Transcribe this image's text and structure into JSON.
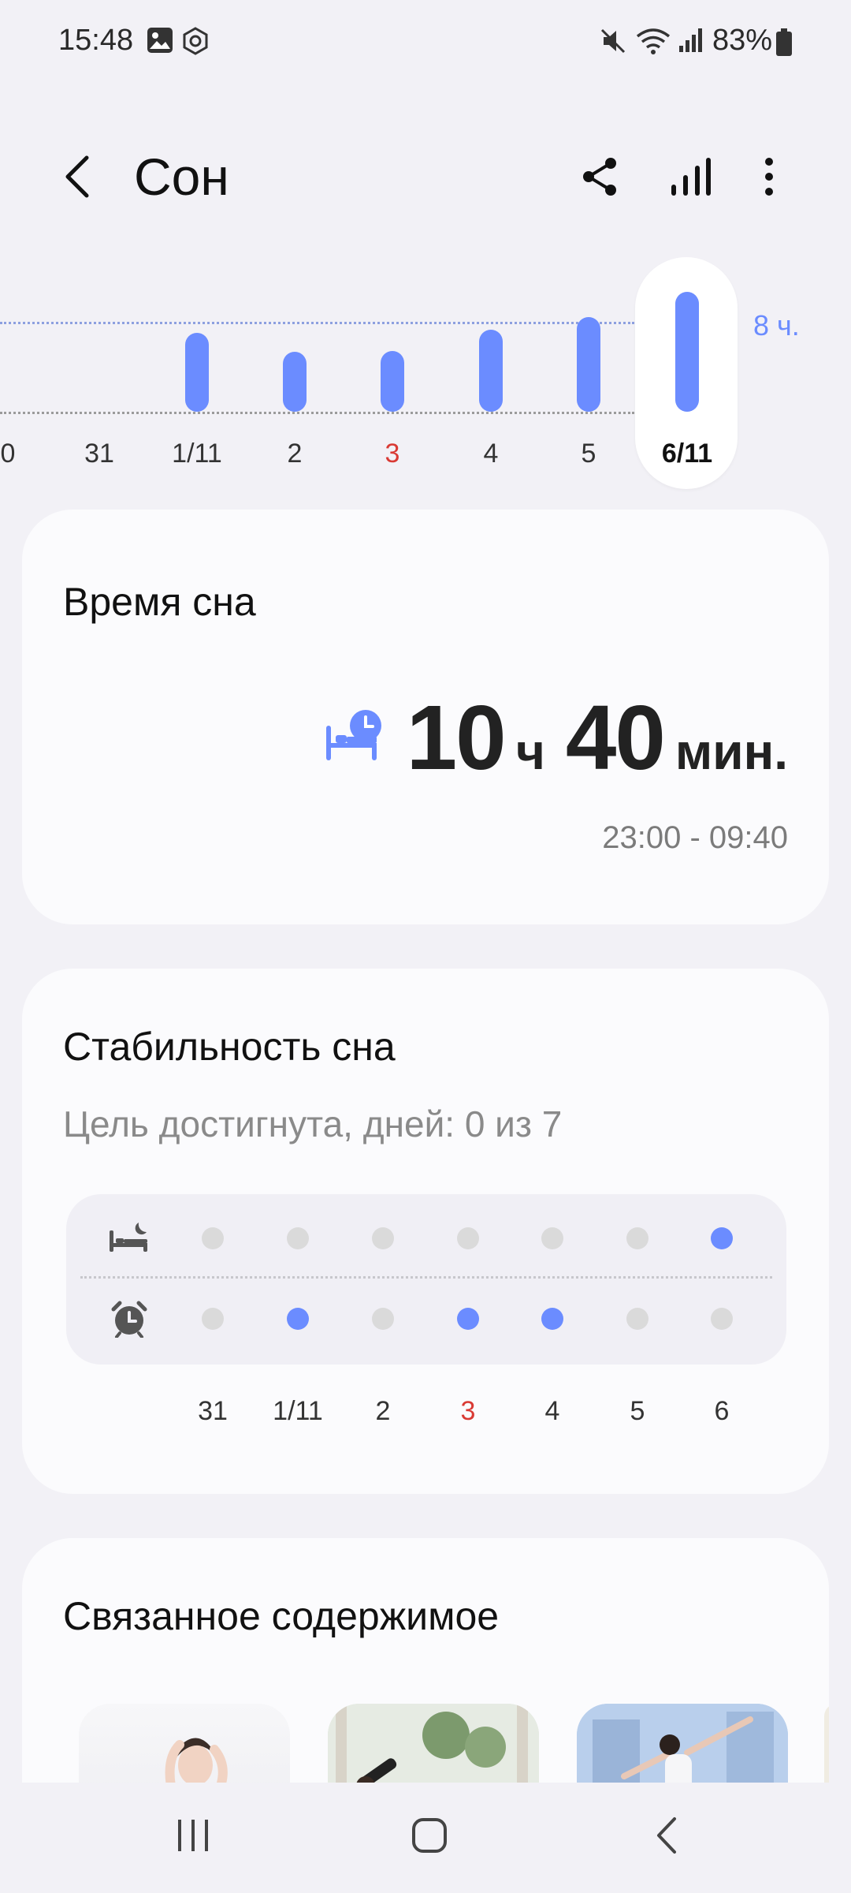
{
  "status_bar": {
    "time": "15:48",
    "battery": "83%",
    "icons": [
      "gallery-icon",
      "sync-icon",
      "mute-icon",
      "wifi-icon",
      "signal-icon",
      "battery-icon"
    ]
  },
  "header": {
    "back_icon": "chevron-left-icon",
    "title": "Сон",
    "actions": [
      "share-icon",
      "chart-icon",
      "more-vertical-icon"
    ]
  },
  "week_chart": {
    "goal_label": "8 ч.",
    "selected_day": "6/11",
    "days": [
      {
        "label": "0",
        "hours": null,
        "red": false
      },
      {
        "label": "31",
        "hours": null,
        "red": false
      },
      {
        "label": "1/11",
        "hours": 7.0,
        "red": false
      },
      {
        "label": "2",
        "hours": 5.3,
        "red": false
      },
      {
        "label": "3",
        "hours": 5.4,
        "red": true
      },
      {
        "label": "4",
        "hours": 7.3,
        "red": false
      },
      {
        "label": "5",
        "hours": 8.4,
        "red": false
      },
      {
        "label": "6/11",
        "hours": 10.67,
        "red": false
      }
    ]
  },
  "sleep_time": {
    "title": "Время сна",
    "icon": "bed-clock-icon",
    "hours": "10",
    "hours_unit": "ч",
    "minutes": "40",
    "minutes_unit": "мин.",
    "range": "23:00 - 09:40"
  },
  "consistency": {
    "title": "Стабильность сна",
    "subtitle": "Цель достигнута, дней: 0 из 7",
    "bedtime_icon": "bedtime-icon",
    "wakeup_icon": "alarm-clock-icon",
    "days": [
      {
        "label": "31",
        "red": false,
        "bedtime": false,
        "wakeup": false
      },
      {
        "label": "1/11",
        "red": false,
        "bedtime": false,
        "wakeup": true
      },
      {
        "label": "2",
        "red": false,
        "bedtime": false,
        "wakeup": false
      },
      {
        "label": "3",
        "red": true,
        "bedtime": false,
        "wakeup": true
      },
      {
        "label": "4",
        "red": false,
        "bedtime": false,
        "wakeup": true
      },
      {
        "label": "5",
        "red": false,
        "bedtime": false,
        "wakeup": false
      },
      {
        "label": "6",
        "red": false,
        "bedtime": true,
        "wakeup": false
      }
    ]
  },
  "related": {
    "title": "Связанное содержимое",
    "items": [
      "stretching-thumbnail",
      "workout-thumbnail",
      "yoga-thumbnail"
    ]
  },
  "nav_bar": [
    "recents-icon",
    "home-icon",
    "back-icon"
  ],
  "colors": {
    "accent": "#6b8cff",
    "weekend": "#d93a34",
    "background": "#f2f1f6",
    "card": "#fbfbfd"
  }
}
